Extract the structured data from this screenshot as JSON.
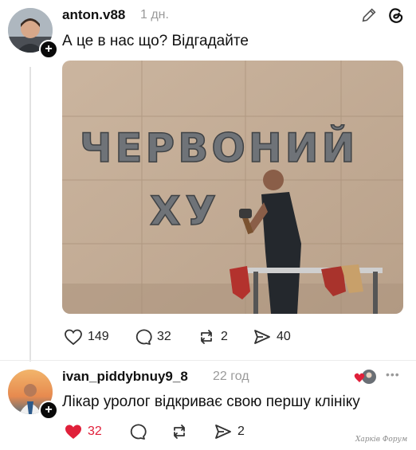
{
  "post": {
    "username": "anton.v88",
    "time": "1 дн.",
    "text": "А це в нас що? Відгадайте",
    "image": {
      "sign_line1": "ЧЕРВОНИЙ",
      "sign_line2": "ХУ"
    },
    "stats": {
      "likes": "149",
      "comments": "32",
      "reposts": "2",
      "shares": "40"
    }
  },
  "reply": {
    "username": "ivan_piddybnuy9_8",
    "time": "22 год",
    "text": "Лікар уролог відкриває свою першу клініку",
    "stats": {
      "likes": "32",
      "shares": "2"
    },
    "more_label": "•••"
  },
  "watermark": "Харків Форум",
  "colors": {
    "like_red": "#e0203a",
    "muted": "#9a9a9a",
    "line": "#e2e2e2"
  },
  "icons": [
    "pencil-icon",
    "threads-logo-icon",
    "heart-icon",
    "comment-icon",
    "repost-icon",
    "share-icon",
    "more-icon"
  ]
}
